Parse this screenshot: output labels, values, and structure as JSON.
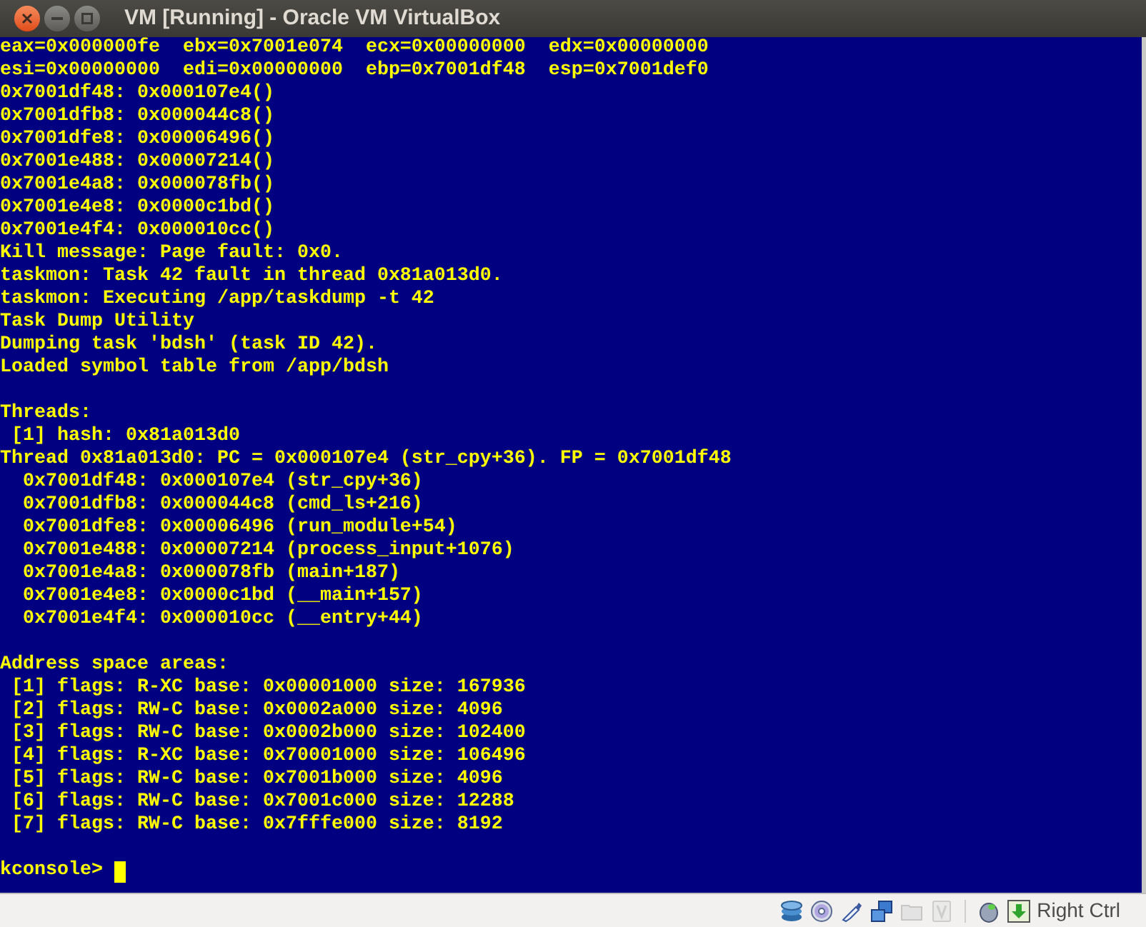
{
  "window": {
    "title": "VM [Running] - Oracle VM VirtualBox"
  },
  "console": {
    "blocks": [
      [
        "eax=0x000000fe  ebx=0x7001e074  ecx=0x00000000  edx=0x00000000",
        "esi=0x00000000  edi=0x00000000  ebp=0x7001df48  esp=0x7001def0",
        "0x7001df48: 0x000107e4()",
        "0x7001dfb8: 0x000044c8()",
        "0x7001dfe8: 0x00006496()",
        "0x7001e488: 0x00007214()",
        "0x7001e4a8: 0x000078fb()",
        "0x7001e4e8: 0x0000c1bd()",
        "0x7001e4f4: 0x000010cc()",
        "Kill message: Page fault: 0x0.",
        "taskmon: Task 42 fault in thread 0x81a013d0.",
        "taskmon: Executing /app/taskdump -t 42",
        "Task Dump Utility",
        "Dumping task 'bdsh' (task ID 42).",
        "Loaded symbol table from /app/bdsh"
      ],
      [
        "Threads:",
        " [1] hash: 0x81a013d0",
        "Thread 0x81a013d0: PC = 0x000107e4 (str_cpy+36). FP = 0x7001df48",
        "  0x7001df48: 0x000107e4 (str_cpy+36)",
        "  0x7001dfb8: 0x000044c8 (cmd_ls+216)",
        "  0x7001dfe8: 0x00006496 (run_module+54)",
        "  0x7001e488: 0x00007214 (process_input+1076)",
        "  0x7001e4a8: 0x000078fb (main+187)",
        "  0x7001e4e8: 0x0000c1bd (__main+157)",
        "  0x7001e4f4: 0x000010cc (__entry+44)"
      ],
      [
        "Address space areas:",
        " [1] flags: R-XC base: 0x00001000 size: 167936",
        " [2] flags: RW-C base: 0x0002a000 size: 4096",
        " [3] flags: RW-C base: 0x0002b000 size: 102400",
        " [4] flags: R-XC base: 0x70001000 size: 106496",
        " [5] flags: RW-C base: 0x7001b000 size: 4096",
        " [6] flags: RW-C base: 0x7001c000 size: 12288",
        " [7] flags: RW-C base: 0x7fffe000 size: 8192"
      ]
    ],
    "prompt": "kconsole>"
  },
  "status_bar": {
    "devices": [
      {
        "kind": "disk",
        "disabled": false
      },
      {
        "kind": "optical",
        "disabled": false
      },
      {
        "kind": "usb",
        "disabled": false
      },
      {
        "kind": "network",
        "disabled": false
      },
      {
        "kind": "folder",
        "disabled": true
      },
      {
        "kind": "capture",
        "disabled": true
      }
    ],
    "host_key": "Right Ctrl"
  }
}
